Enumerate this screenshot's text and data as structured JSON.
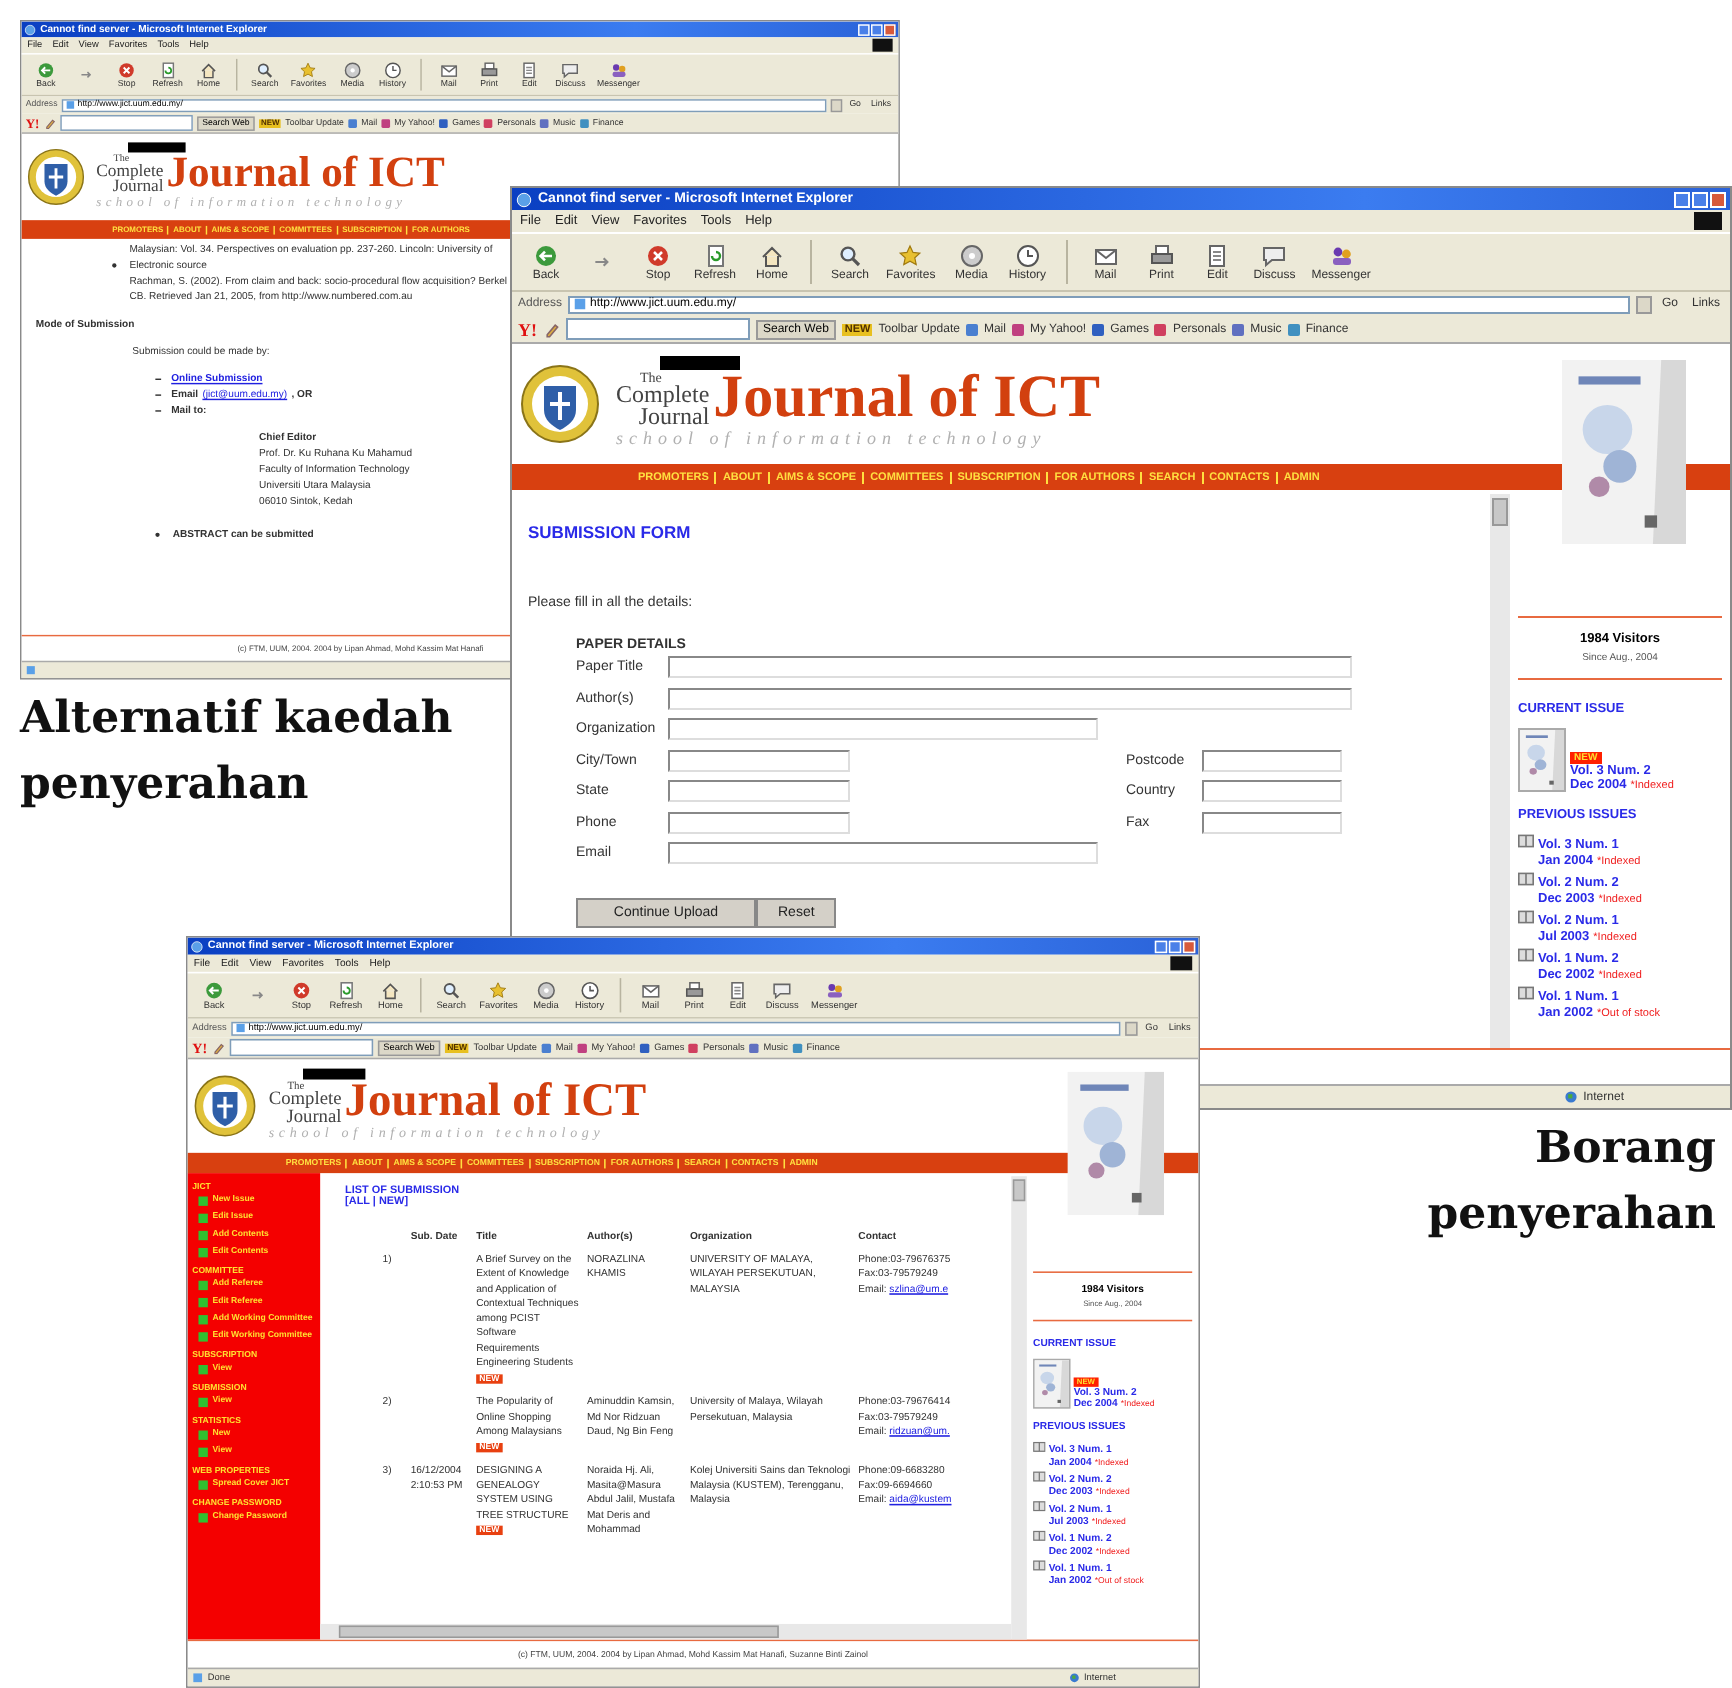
{
  "windows": [
    {
      "title": "Cannot find server - Microsoft Internet Explorer",
      "menu": [
        "File",
        "Edit",
        "View",
        "Favorites",
        "Tools",
        "Help"
      ],
      "toolbar": [
        "Back",
        "Stop",
        "Refresh",
        "Home",
        "Search",
        "Favorites",
        "Media",
        "History",
        "Mail",
        "Print",
        "Edit",
        "Discuss",
        "Messenger"
      ],
      "address": {
        "label": "Address",
        "url": "http://www.jict.uum.edu.my/",
        "go": "Go",
        "links": "Links"
      },
      "yahoo": {
        "logo": "Y!",
        "search_button": "Search Web",
        "update_badge": "NEW",
        "update": "Toolbar Update",
        "items": [
          "Mail",
          "My Yahoo!",
          "Games",
          "Personals",
          "Music",
          "Finance"
        ]
      },
      "header": {
        "the": "The",
        "complete": "Complete",
        "journal": "Journal",
        "title": "Journal of ICT",
        "subtitle": "school of information technology"
      },
      "nav": [
        "PROMOTERS",
        "ABOUT",
        "AIMS & SCOPE",
        "COMMITTEES",
        "SUBSCRIPTION",
        "FOR AUTHORS"
      ],
      "content": {
        "kind": "article",
        "lines": [
          {
            "kind": "text",
            "text": "Malaysian: Vol. 34. Perspectives on evaluation pp. 237-260. Lincoln: University of"
          },
          {
            "kind": "bullet",
            "text": "Electronic source"
          },
          {
            "kind": "text",
            "text": "Rachman, S. (2002). From claim and back: socio-procedural flow acquisition? Berkel"
          },
          {
            "kind": "text",
            "text": "CB. Retrieved Jan 21, 2005, from http://www.numbered.com.au"
          },
          {
            "kind": "heading",
            "text": "Mode of Submission"
          },
          {
            "kind": "para",
            "text": "Submission could be made by:"
          },
          {
            "kind": "link",
            "text": "Online Submission"
          },
          {
            "kind": "email",
            "label": "Email",
            "link": "(jict@uum.edu.my)",
            "rest": ", OR"
          },
          {
            "kind": "item",
            "text": "Mail to:"
          },
          {
            "kind": "address-title",
            "text": "Chief Editor"
          },
          {
            "kind": "address",
            "text": "Prof. Dr. Ku Ruhana Ku Mahamud"
          },
          {
            "kind": "address",
            "text": "Faculty of Information Technology"
          },
          {
            "kind": "address",
            "text": "Universiti Utara Malaysia"
          },
          {
            "kind": "address",
            "text": "06010 Sintok, Kedah"
          },
          {
            "kind": "note",
            "text": "ABSTRACT can be submitted"
          }
        ]
      },
      "footer": "(c) FTM, UUM, 2004. 2004 by Lipan Ahmad, Mohd Kassim Mat Hanafi",
      "status": {
        "icon": true
      }
    },
    {
      "title": "Cannot find server - Microsoft Internet Explorer",
      "menu": [
        "File",
        "Edit",
        "View",
        "Favorites",
        "Tools",
        "Help"
      ],
      "toolbar": [
        "Back",
        "Stop",
        "Refresh",
        "Home",
        "Search",
        "Favorites",
        "Media",
        "History",
        "Mail",
        "Print",
        "Edit",
        "Discuss",
        "Messenger"
      ],
      "address": {
        "label": "Address",
        "url": "http://www.jict.uum.edu.my/",
        "go": "Go",
        "links": "Links"
      },
      "yahoo": {
        "logo": "Y!",
        "search_button": "Search Web",
        "update_badge": "NEW",
        "update": "Toolbar Update",
        "items": [
          "Mail",
          "My Yahoo!",
          "Games",
          "Personals",
          "Music",
          "Finance"
        ]
      },
      "header": {
        "the": "The",
        "complete": "Complete",
        "journal": "Journal",
        "title": "Journal of ICT",
        "subtitle": "school of information technology"
      },
      "nav": [
        "PROMOTERS",
        "ABOUT",
        "AIMS & SCOPE",
        "COMMITTEES",
        "SUBSCRIPTION",
        "FOR AUTHORS",
        "SEARCH",
        "CONTACTS",
        "ADMIN"
      ],
      "content": {
        "kind": "form",
        "heading": "SUBMISSION FORM",
        "intro": "Please fill in all the details:",
        "section": "PAPER DETAILS",
        "rows": [
          [
            {
              "label": "Paper Title",
              "kind": "long"
            }
          ],
          [
            {
              "label": "Author(s)",
              "kind": "long"
            }
          ],
          [
            {
              "label": "Organization",
              "kind": "medium"
            }
          ],
          [
            {
              "label": "City/Town",
              "kind": "short"
            },
            {
              "label": "Postcode",
              "kind": "short"
            }
          ],
          [
            {
              "label": "State",
              "kind": "short"
            },
            {
              "label": "Country",
              "kind": "short"
            }
          ],
          [
            {
              "label": "Phone",
              "kind": "short"
            },
            {
              "label": "Fax",
              "kind": "short"
            }
          ],
          [
            {
              "label": "Email",
              "kind": "medium"
            }
          ]
        ],
        "buttons": [
          "Continue Upload",
          "Reset"
        ]
      },
      "right": {
        "visitors": "1984 Visitors",
        "since": "Since Aug., 2004",
        "current_heading": "CURRENT ISSUE",
        "current": {
          "badge": "NEW",
          "vol": "Vol. 3 Num. 2",
          "date": "Dec 2004",
          "note": "*Indexed"
        },
        "previous_heading": "PREVIOUS ISSUES",
        "previous": [
          {
            "vol": "Vol. 3 Num. 1",
            "date": "Jan 2004",
            "note": "*Indexed"
          },
          {
            "vol": "Vol. 2 Num. 2",
            "date": "Dec 2003",
            "note": "*Indexed"
          },
          {
            "vol": "Vol. 2 Num. 1",
            "date": "Jul 2003",
            "note": "*Indexed"
          },
          {
            "vol": "Vol. 1 Num. 2",
            "date": "Dec 2002",
            "note": "*Indexed"
          },
          {
            "vol": "Vol. 1 Num. 1",
            "date": "Jan 2002",
            "note": "*Out of stock"
          }
        ]
      },
      "status": {
        "zone": "Internet"
      }
    },
    {
      "title": "Cannot find server - Microsoft Internet Explorer",
      "menu": [
        "File",
        "Edit",
        "View",
        "Favorites",
        "Tools",
        "Help"
      ],
      "toolbar": [
        "Back",
        "Stop",
        "Refresh",
        "Home",
        "Search",
        "Favorites",
        "Media",
        "History",
        "Mail",
        "Print",
        "Edit",
        "Discuss",
        "Messenger"
      ],
      "address": {
        "label": "Address",
        "url": "http://www.jict.uum.edu.my/",
        "go": "Go",
        "links": "Links"
      },
      "yahoo": {
        "logo": "Y!",
        "search_button": "Search Web",
        "update_badge": "NEW",
        "update": "Toolbar Update",
        "items": [
          "Mail",
          "My Yahoo!",
          "Games",
          "Personals",
          "Music",
          "Finance"
        ]
      },
      "header": {
        "the": "The",
        "complete": "Complete",
        "journal": "Journal",
        "title": "Journal of ICT",
        "subtitle": "school of information technology"
      },
      "nav": [
        "PROMOTERS",
        "ABOUT",
        "AIMS & SCOPE",
        "COMMITTEES",
        "SUBSCRIPTION",
        "FOR AUTHORS",
        "SEARCH",
        "CONTACTS",
        "ADMIN"
      ],
      "content": {
        "kind": "admin",
        "sidebar": [
          {
            "kind": "heading",
            "text": "JICT"
          },
          {
            "kind": "item",
            "text": "New Issue"
          },
          {
            "kind": "item",
            "text": "Edit Issue"
          },
          {
            "kind": "item",
            "text": "Add Contents"
          },
          {
            "kind": "item",
            "text": "Edit Contents"
          },
          {
            "kind": "heading",
            "text": "COMMITTEE"
          },
          {
            "kind": "item",
            "text": "Add Referee"
          },
          {
            "kind": "item",
            "text": "Edit Referee"
          },
          {
            "kind": "item",
            "text": "Add Working Committee"
          },
          {
            "kind": "item",
            "text": "Edit Working Committee"
          },
          {
            "kind": "heading",
            "text": "SUBSCRIPTION"
          },
          {
            "kind": "item",
            "text": "View"
          },
          {
            "kind": "heading",
            "text": "SUBMISSION"
          },
          {
            "kind": "item",
            "text": "View"
          },
          {
            "kind": "heading",
            "text": "STATISTICS"
          },
          {
            "kind": "item",
            "text": "New"
          },
          {
            "kind": "item",
            "text": "View"
          },
          {
            "kind": "heading",
            "text": "WEB PROPERTIES"
          },
          {
            "kind": "item",
            "text": "Spread Cover JICT"
          },
          {
            "kind": "heading",
            "text": "CHANGE PASSWORD"
          },
          {
            "kind": "item",
            "text": "Change Password"
          }
        ],
        "heading": "LIST OF SUBMISSION",
        "filter": "[ALL | NEW]",
        "columns": [
          "Sub. Date",
          "Title",
          "Author(s)",
          "Organization",
          "Contact"
        ],
        "rows": [
          {
            "number": "1)",
            "title": "A Brief Survey on the Extent of Knowledge and Application of Contextual Techniques among PCIST Software Requirements Engineering Students",
            "badge": "NEW",
            "authors": "NORAZLINA KHAMIS",
            "organization": "UNIVERSITY OF MALAYA, WILAYAH PERSEKUTUAN, MALAYSIA",
            "phone": "Phone:03-79676375",
            "fax": "Fax:03-79579249",
            "email_label": "Email:",
            "email": "szlina@um.e"
          },
          {
            "number": "2)",
            "title": "The Popularity of Online Shopping Among Malaysians",
            "badge": "NEW",
            "authors": "Aminuddin Kamsin, Md Nor Ridzuan Daud, Ng Bin Feng",
            "organization": "University of Malaya, Wilayah Persekutuan, Malaysia",
            "phone": "Phone:03-79676414",
            "fax": "Fax:03-79579249",
            "email_label": "Email:",
            "email": "ridzuan@um."
          },
          {
            "number": "3)",
            "date": "16/12/2004 2:10:53 PM",
            "title": "DESIGNING A GENEALOGY SYSTEM USING TREE STRUCTURE",
            "badge": "NEW",
            "authors": "Noraida Hj. Ali, Masita@Masura Abdul Jalil, Mustafa Mat Deris and Mohammad",
            "organization": "Kolej Universiti Sains dan Teknologi Malaysia (KUSTEM), Terengganu, Malaysia",
            "phone": "Phone:09-6683280",
            "fax": "Fax:09-6694660",
            "email_label": "Email:",
            "email": "aida@kustem"
          }
        ]
      },
      "right": {
        "visitors": "1984 Visitors",
        "since": "Since Aug., 2004",
        "current_heading": "CURRENT ISSUE",
        "current": {
          "badge": "NEW",
          "vol": "Vol. 3 Num. 2",
          "date": "Dec 2004",
          "note": "*Indexed"
        },
        "previous_heading": "PREVIOUS ISSUES",
        "previous": [
          {
            "vol": "Vol. 3 Num. 1",
            "date": "Jan 2004",
            "note": "*Indexed"
          },
          {
            "vol": "Vol. 2 Num. 2",
            "date": "Dec 2003",
            "note": "*Indexed"
          },
          {
            "vol": "Vol. 2 Num. 1",
            "date": "Jul 2003",
            "note": "*Indexed"
          },
          {
            "vol": "Vol. 1 Num. 2",
            "date": "Dec 2002",
            "note": "*Indexed"
          },
          {
            "vol": "Vol. 1 Num. 1",
            "date": "Jan 2002",
            "note": "*Out of stock"
          }
        ]
      },
      "footer": "(c) FTM, UUM, 2004. 2004 by Lipan Ahmad, Mohd Kassim Mat Hanafi, Suzanne Binti Zainol",
      "status": {
        "icon": true,
        "text": "Done",
        "zone": "Internet"
      }
    }
  ],
  "captions": [
    "Alternatif kaedah penyerahan",
    "Borang penyerahan"
  ]
}
